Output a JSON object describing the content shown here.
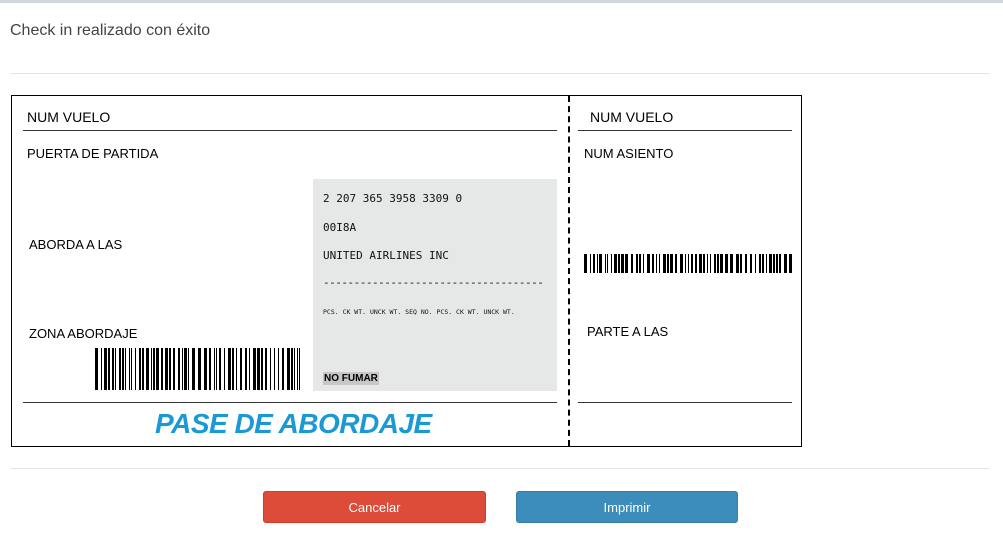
{
  "modal": {
    "title": "Check in realizado con éxito"
  },
  "ticket": {
    "left": {
      "flight_label": "NUM VUELO",
      "gate_label": "PUERTA DE PARTIDA",
      "boards_label": "ABORDA A LAS",
      "zone_label": "ZONA ABORDAJE"
    },
    "center": {
      "ticket_number": "2 207 365 3958 3309 0",
      "code": "00I8A",
      "airline": "UNITED AIRLINES INC",
      "separator": "------------------------------------",
      "columns": "PCS. CK WT. UNCK WT. SEQ NO. PCS. CK WT. UNCK WT.",
      "no_smoking": "NO FUMAR"
    },
    "right": {
      "flight_label": "NUM VUELO",
      "seat_label": "NUM ASIENTO",
      "departs_label": "PARTE A LAS"
    },
    "footer_title": "PASE DE ABORDAJE",
    "footer_color": "#1b99d4"
  },
  "buttons": {
    "cancel": "Cancelar",
    "print": "Imprimir"
  },
  "colors": {
    "cancel": "#dd4b39",
    "print": "#3c8dbc"
  }
}
